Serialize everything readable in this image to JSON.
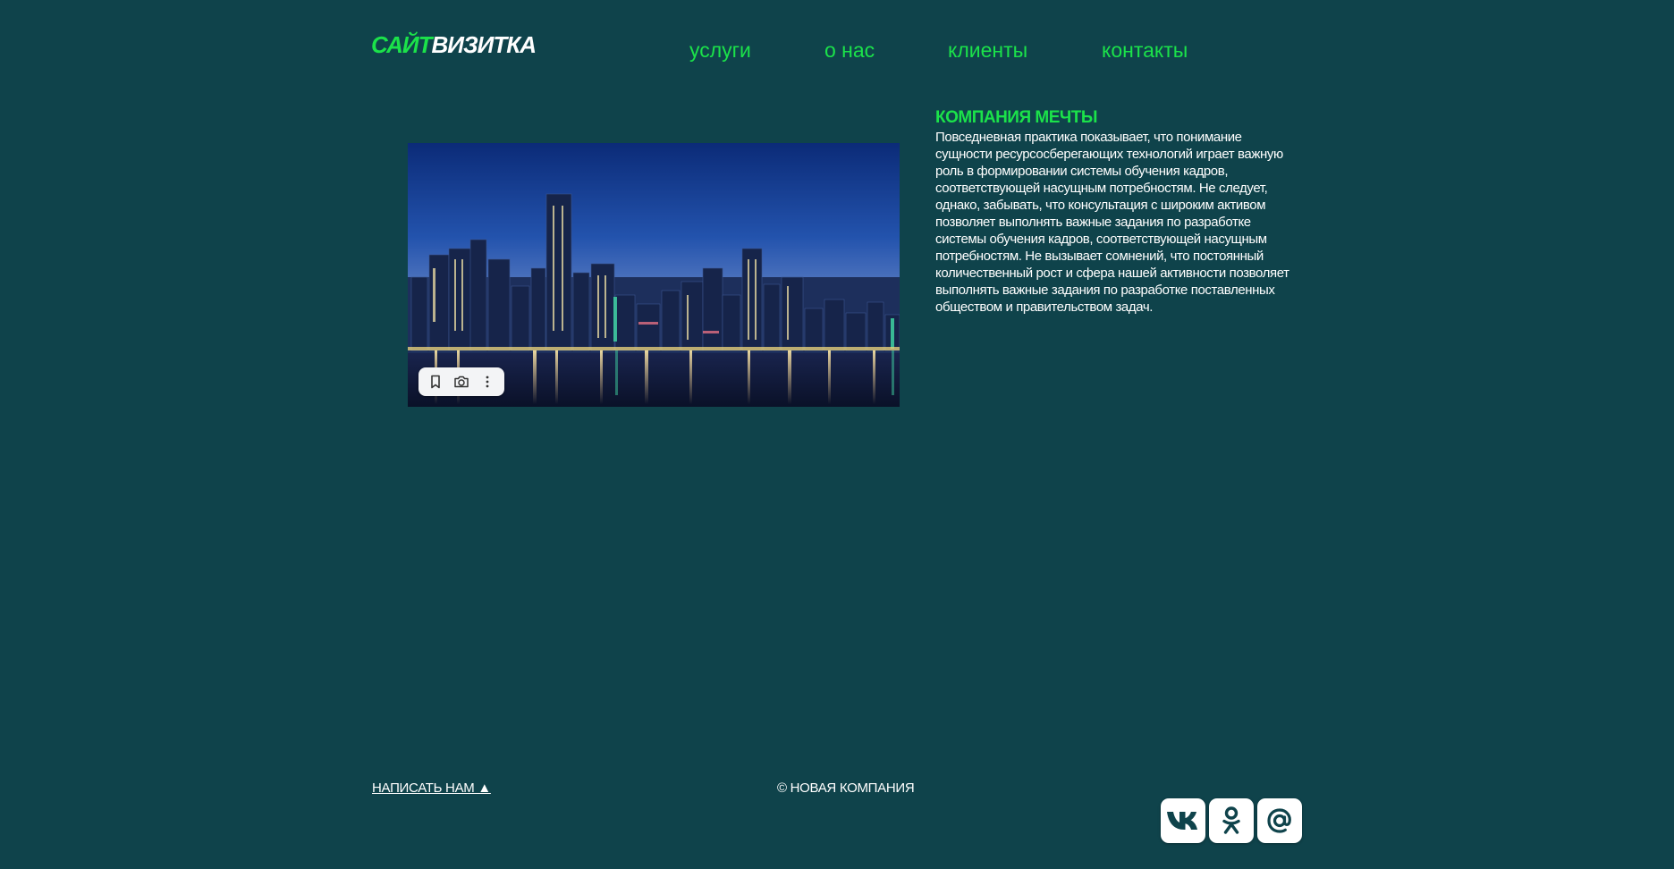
{
  "logo": {
    "part1": "САЙТ",
    "part2": "ВИЗИТКА"
  },
  "nav": {
    "items": [
      {
        "label": "услуги"
      },
      {
        "label": "о нас"
      },
      {
        "label": "клиенты"
      },
      {
        "label": "контакты"
      }
    ]
  },
  "photo": {
    "toolbar": {
      "icons": [
        "bookmark-icon",
        "camera-icon",
        "more-vertical-icon"
      ]
    }
  },
  "about": {
    "title": "КОМПАНИЯ МЕЧТЫ",
    "text": "Повседневная практика показывает, что понимание сущности ресурсосберегающих технологий играет важную роль в формировании системы обучения кадров, соответствующей насущным потребностям. Не следует, однако, забывать, что консультация с широким активом позволяет выполнять важные задания по разработке системы обучения кадров, соответствующей насущным потребностям. Не вызывает сомнений, что постоянный количественный рост и сфера нашей активности позволяет выполнять важные задания по разработке поставленных обществом и правительством задач."
  },
  "footer": {
    "write_label": "НАПИСАТЬ НАМ ▲",
    "copyright": "© НОВАЯ КОМПАНИЯ",
    "socials": [
      "vk-icon",
      "odnoklassniki-icon",
      "email-icon"
    ]
  },
  "colors": {
    "background": "#0f434b",
    "accent": "#1be24a",
    "text": "#ffffff"
  }
}
